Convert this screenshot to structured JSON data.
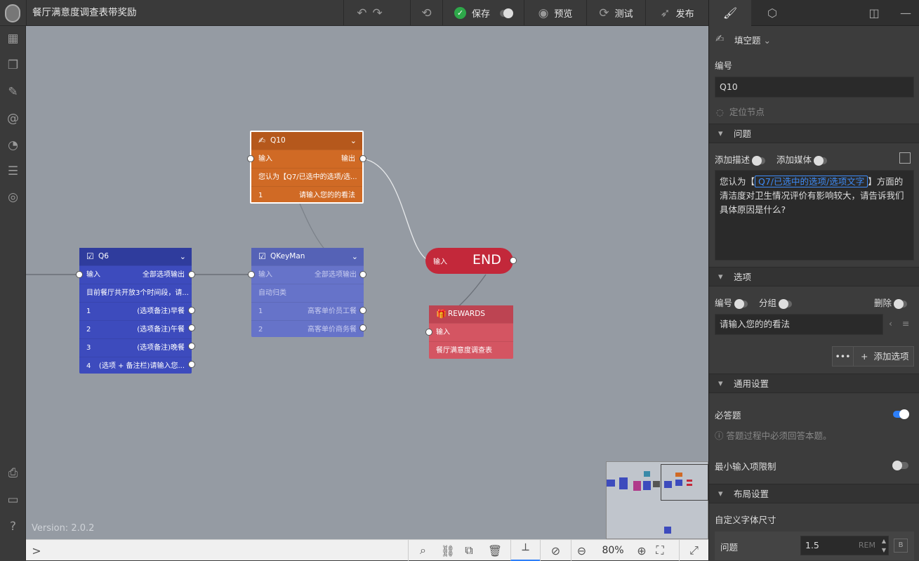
{
  "app": {
    "title": "餐厅满意度调查表带奖励",
    "version": "Version: 2.0.2"
  },
  "toolbar": {
    "undo_icon": "undo-icon",
    "redo_icon": "redo-icon",
    "reset_icon": "reset-icon",
    "save_label": "保存",
    "preview_label": "预览",
    "test_label": "测试",
    "publish_label": "发布"
  },
  "nodes": {
    "q10": {
      "title": "Q10",
      "input": "输入",
      "output": "输出",
      "text": "您认为【Q7/已选中的选项/选...",
      "opt_num": "1",
      "opt_text": "请输入您的的看法"
    },
    "q6": {
      "title": "Q6",
      "input": "输入",
      "output": "全部选项输出",
      "text": "目前餐厅共开放3个时间段，请...",
      "options": [
        {
          "num": "1",
          "text": "(选项备注)早餐"
        },
        {
          "num": "2",
          "text": "(选项备注)午餐"
        },
        {
          "num": "3",
          "text": "(选项备注)晚餐"
        },
        {
          "num": "4",
          "text": "(选项 + 备注栏)请输入您..."
        }
      ]
    },
    "qkeyman": {
      "title": "QKeyMan",
      "input": "输入",
      "output": "全部选项输出",
      "text": "自动归类",
      "options": [
        {
          "num": "1",
          "text": "高客单价员工餐"
        },
        {
          "num": "2",
          "text": "高客单价商务餐"
        }
      ]
    },
    "end": {
      "input": "输入",
      "label": "END"
    },
    "rewards": {
      "title": "REWARDS",
      "input": "输入",
      "text": "餐厅满意度调查表"
    }
  },
  "bottom": {
    "expand": ">",
    "zoom": "80%"
  },
  "panel": {
    "type_label": "填空题",
    "number_label": "编号",
    "number_value": "Q10",
    "locate_label": "定位节点",
    "question_section": "问题",
    "add_desc_label": "添加描述",
    "add_media_label": "添加媒体",
    "question_prefix": "您认为【",
    "question_tag": "Q7/已选中的选项/选项文字",
    "question_mid": "】方面的",
    "question_rest": "清洁度对卫生情况评价有影响较大，请告诉我们具体原因是什么?",
    "options_section": "选项",
    "opt_number_label": "编号",
    "opt_group_label": "分组",
    "opt_delete_label": "删除",
    "option_value": "请输入您的的看法",
    "add_option_label": "添加选项",
    "general_section": "通用设置",
    "required_label": "必答题",
    "required_hint": "答题过程中必须回答本题。",
    "min_input_label": "最小输入项限制",
    "layout_section": "布局设置",
    "font_size_label": "自定义字体尺寸",
    "question_size_label": "问题",
    "question_size_value": "1.5",
    "question_size_unit": "REM",
    "question_size_b": "B"
  },
  "colors": {
    "q10": "#d06a25",
    "q6": "#3d4bbd",
    "qkeyman": "#6673c9",
    "end": "#c3283a",
    "rewards": "#d45562",
    "canvas": "#959ba3",
    "accent": "#2d7ff9"
  }
}
